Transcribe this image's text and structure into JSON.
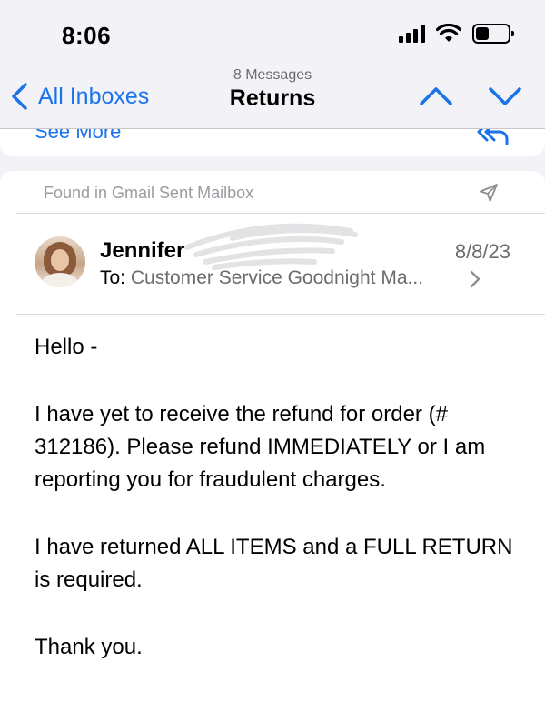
{
  "status_bar": {
    "time": "8:06",
    "icons": [
      "cellular-signal-icon",
      "wifi-icon",
      "battery-icon"
    ]
  },
  "nav": {
    "back_label": "All Inboxes",
    "subtitle": "8 Messages",
    "title": "Returns",
    "icons": [
      "chevron-left-icon",
      "chevron-up-icon",
      "chevron-down-icon"
    ]
  },
  "previous_message": {
    "see_more_label": "See More",
    "icon": "reply-all-icon"
  },
  "message": {
    "found_in": "Found in Gmail Sent Mailbox",
    "found_in_icon": "sent-arrow-icon",
    "sender_name": "Jennifer",
    "date": "8/8/23",
    "to_label": "To:",
    "to_value": "Customer Service Goodnight Ma...",
    "body": [
      "Hello -",
      "I have yet to receive the refund for order (# 312186). Please refund IMMEDIATELY or I am reporting you for fraudulent charges.",
      "I have returned ALL ITEMS and a FULL RETURN is required.",
      "Thank you."
    ]
  },
  "colors": {
    "accent": "#1a73e8",
    "background": "#f2f2f7",
    "secondary_text": "#6b6b70"
  }
}
